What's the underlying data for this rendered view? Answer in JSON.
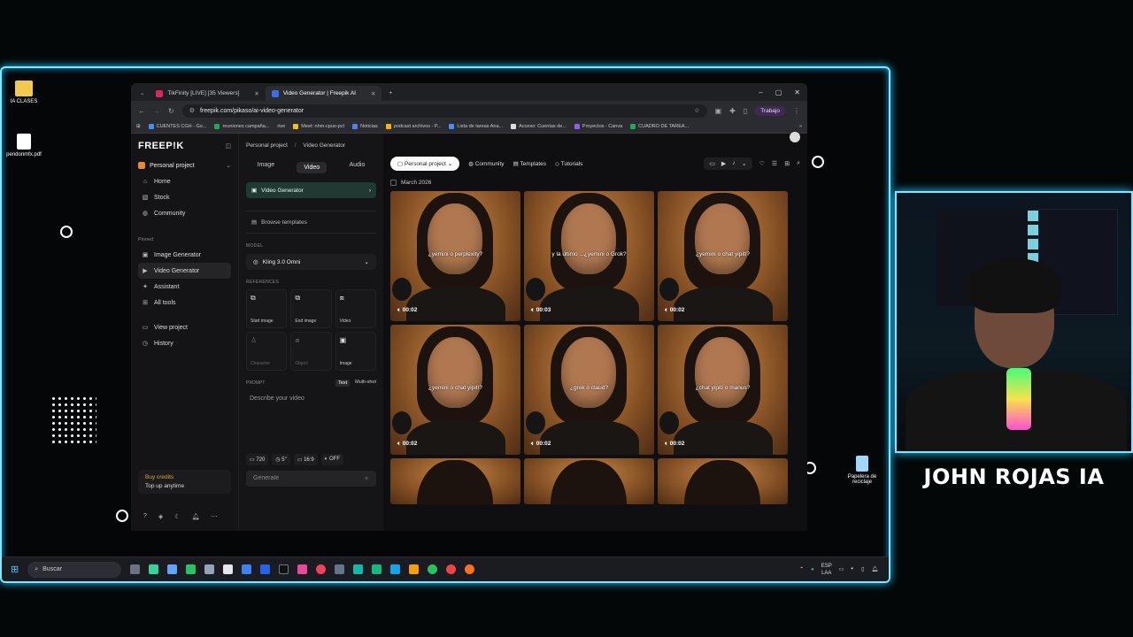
{
  "desktop": {
    "icons": [
      {
        "label": "IA CLASES",
        "icon": "folder-icon"
      },
      {
        "label": "pendonmfx.pdf",
        "icon": "chrome-pdf-icon"
      },
      {
        "label": "Papelera de reciclaje",
        "icon": "recycle-bin-icon"
      }
    ]
  },
  "browser": {
    "tabs": [
      {
        "label": "TikFinity [LIVE] [35 Viewers]",
        "active": false
      },
      {
        "label": "Video Generator | Freepik AI",
        "active": true
      }
    ],
    "url": "freepik.com/pikaso/ai-video-generator",
    "profile": "Trabajo",
    "bookmarks": [
      "CUENTES CGH - Go...",
      "reuniones campaña...",
      "rive",
      "Meet: nhm-cpuo-pct",
      "Noticias",
      "podcast archivos - P...",
      "Lista de tareas Ana...",
      "Acceso: Cuentas de...",
      "Proyectos - Canva",
      "CUADRO DE TAREA..."
    ]
  },
  "sidebar": {
    "logo": "FREEP!K",
    "project": "Personal project",
    "nav": [
      "Home",
      "Stock",
      "Community"
    ],
    "pinned_label": "Pinned",
    "pinned": [
      "Image Generator",
      "Video Generator",
      "Assistant",
      "All tools"
    ],
    "extra": [
      "View project",
      "History"
    ],
    "credits": {
      "title": "Buy credits",
      "sub": "Top up anytime"
    }
  },
  "breadcrumb": {
    "root": "Personal project",
    "sep": "/",
    "current": "Video Generator"
  },
  "panel": {
    "tabs": [
      "Image",
      "Video",
      "Audio"
    ],
    "active_tool": "Video Generator",
    "browse": "Browse templates",
    "model_label": "MODEL",
    "model": "Kling 3.0 Omni",
    "refs_label": "REFERENCES",
    "refs": [
      {
        "label": "Start image",
        "icon": "start-image-icon",
        "dim": false
      },
      {
        "label": "End image",
        "icon": "end-image-icon",
        "dim": false
      },
      {
        "label": "Video",
        "icon": "video-icon",
        "dim": false
      },
      {
        "label": "Character",
        "icon": "character-icon",
        "dim": true
      },
      {
        "label": "Object",
        "icon": "object-icon",
        "dim": true
      },
      {
        "label": "Image",
        "icon": "image-icon",
        "dim": false
      }
    ],
    "prompt_label": "PROMPT",
    "prompt_modes": [
      "Text",
      "Multi-shot"
    ],
    "prompt_placeholder": "Describe your video",
    "options": [
      "720",
      "5\"",
      "16:9",
      "OFF"
    ],
    "generate": "Generate"
  },
  "main": {
    "filter_project": "Personal project",
    "filters": [
      "Community",
      "Templates",
      "Tutorials"
    ],
    "date_group": "March 2026",
    "videos": [
      {
        "caption": "¿yemini o perplexity?",
        "duration": "00:02"
      },
      {
        "caption": "y la último ...¿yemini o Grok?",
        "duration": "00:03"
      },
      {
        "caption": "¿yemini o chat yipití?",
        "duration": "00:02"
      },
      {
        "caption": "¿yemini o chat yipití?",
        "duration": "00:02"
      },
      {
        "caption": "¿grok o claud?",
        "duration": "00:02"
      },
      {
        "caption": "¿chat yipití o manus?",
        "duration": "00:02"
      }
    ]
  },
  "taskbar": {
    "search": "Buscar",
    "lang": "ESP",
    "region": "LAA"
  },
  "streamer": {
    "name": "JOHN ROJAS IA"
  }
}
